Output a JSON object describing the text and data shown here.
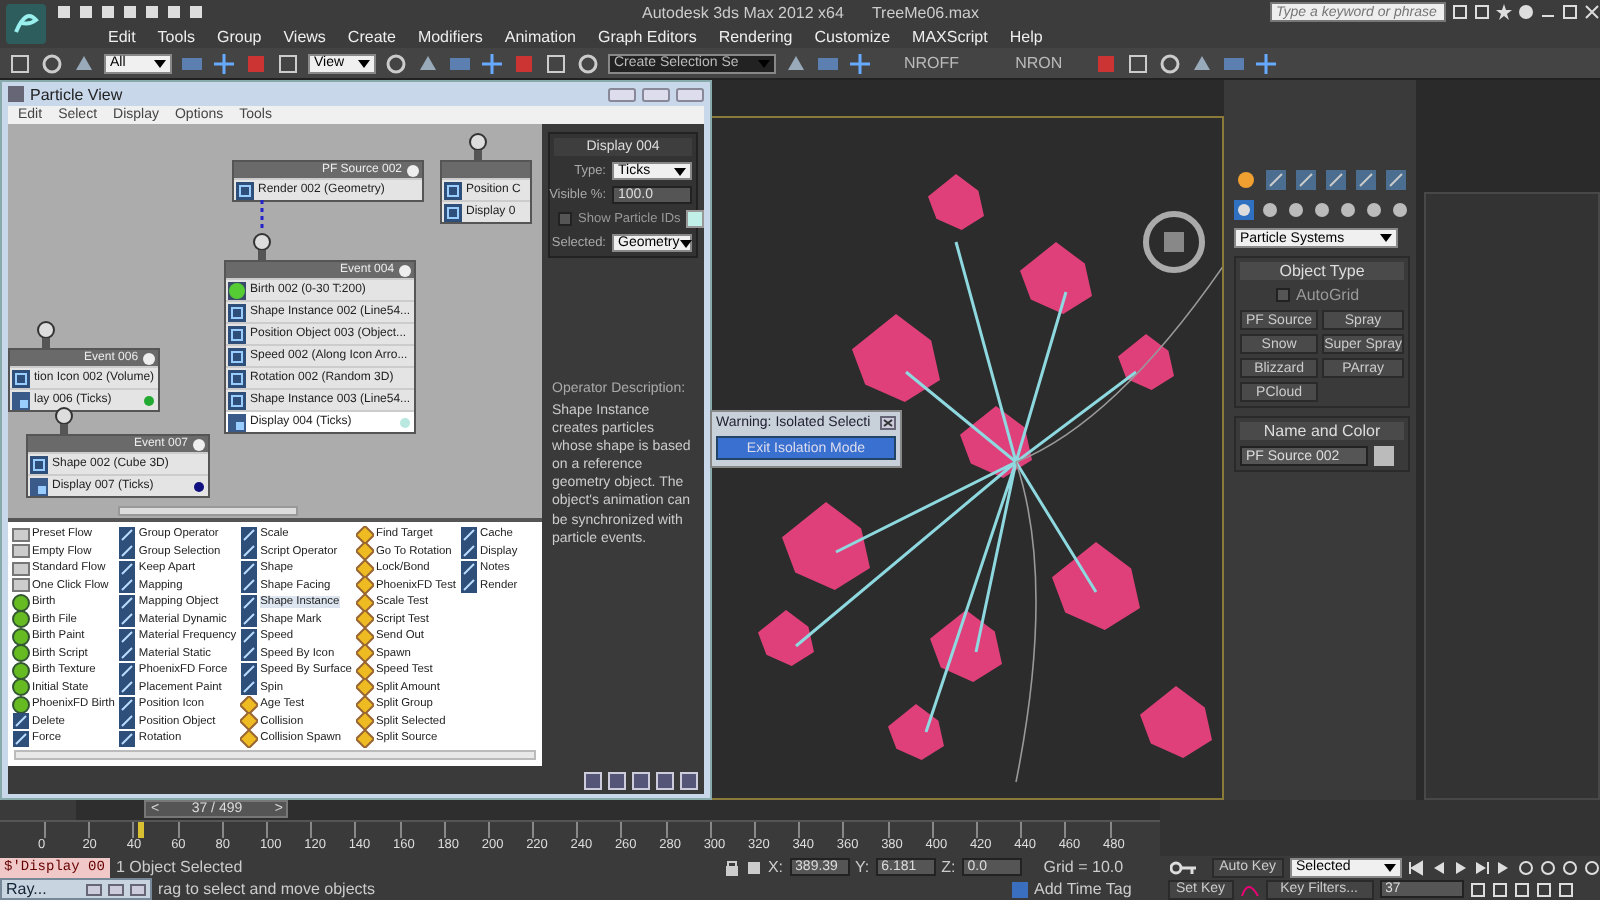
{
  "app": {
    "title": "Autodesk 3ds Max  2012 x64",
    "file": "TreeMe06.max",
    "search": {
      "placeholder": "Type a keyword or phrase"
    }
  },
  "menu": [
    "Edit",
    "Tools",
    "Group",
    "Views",
    "Create",
    "Modifiers",
    "Animation",
    "Graph Editors",
    "Rendering",
    "Customize",
    "MAXScript",
    "Help"
  ],
  "toolbar": [
    {
      "kind": "dropdown",
      "value": "All"
    },
    {
      "kind": "dropdown",
      "value": "View"
    },
    {
      "kind": "dropdown",
      "value": "Create Selection Se"
    },
    {
      "kind": "label",
      "text": "NROFF"
    },
    {
      "kind": "label",
      "text": "NRON"
    }
  ],
  "particle_view": {
    "title": "Particle View",
    "menu": [
      "Edit",
      "Select",
      "Display",
      "Options",
      "Tools"
    ],
    "nodes": [
      {
        "title": "PF Source 002",
        "kind": "source",
        "operators": [
          {
            "label": "Render 002 (Geometry)",
            "kind": "operator",
            "selected": false
          }
        ]
      },
      {
        "kind": "partial",
        "operators": [
          {
            "label": "Position C",
            "kind": "operator",
            "selected": false
          },
          {
            "label": "Display 0",
            "kind": "operator",
            "selected": false
          }
        ]
      },
      {
        "title": "Event 004",
        "kind": "event",
        "operators": [
          {
            "label": "Birth 002 (0-30 T:200)",
            "kind": "birth",
            "selected": false
          },
          {
            "label": "Shape Instance 002 (Line54...",
            "kind": "operator",
            "selected": false
          },
          {
            "label": "Position Object 003 (Object...",
            "kind": "operator",
            "selected": false
          },
          {
            "label": "Speed 002 (Along Icon Arro...",
            "kind": "operator",
            "selected": false
          },
          {
            "label": "Rotation 002 (Random 3D)",
            "kind": "operator",
            "selected": false
          },
          {
            "label": "Shape Instance 003 (Line54...",
            "kind": "operator",
            "selected": false
          },
          {
            "label": "Display 004 (Ticks)",
            "kind": "display",
            "selected": true,
            "color": "#b8e8e0"
          }
        ]
      },
      {
        "title": "Event 006",
        "kind": "event",
        "operators": [
          {
            "label": "tion Icon 002 (Volume)",
            "kind": "operator",
            "selected": false
          },
          {
            "label": "lay 006 (Ticks)",
            "kind": "display",
            "selected": false,
            "color": "#22aa33"
          }
        ]
      },
      {
        "title": "Event 007",
        "kind": "event",
        "operators": [
          {
            "label": "Shape 002 (Cube 3D)",
            "kind": "operator",
            "selected": false
          },
          {
            "label": "Display 007 (Ticks)",
            "kind": "display",
            "selected": false,
            "color": "#101080"
          }
        ]
      }
    ],
    "params": {
      "title": "Display 004",
      "type": {
        "label": "Type:",
        "value": "Ticks"
      },
      "visible": {
        "label": "Visible %:",
        "value": "100.0"
      },
      "show_ids": {
        "label": "Show Particle IDs",
        "checked": false
      },
      "selected": {
        "label": "Selected:",
        "value": "Geometry"
      }
    },
    "depot": {
      "columns": [
        [
          {
            "label": "Preset Flow",
            "kind": "flow",
            "selected": false
          },
          {
            "label": "Empty Flow",
            "kind": "flow",
            "selected": false
          },
          {
            "label": "Standard Flow",
            "kind": "flow",
            "selected": false
          },
          {
            "label": "One Click Flow",
            "kind": "flow",
            "selected": false
          },
          {
            "label": "Birth",
            "kind": "birth",
            "selected": false
          },
          {
            "label": "Birth File",
            "kind": "birth",
            "selected": false
          },
          {
            "label": "Birth Paint",
            "kind": "birth",
            "selected": false
          },
          {
            "label": "Birth Script",
            "kind": "birth",
            "selected": false
          },
          {
            "label": "Birth Texture",
            "kind": "birth",
            "selected": false
          },
          {
            "label": "Initial State",
            "kind": "birth",
            "selected": false
          },
          {
            "label": "PhoenixFD Birth",
            "kind": "birth",
            "selected": false
          },
          {
            "label": "Delete",
            "kind": "operator",
            "selected": false
          },
          {
            "label": "Force",
            "kind": "operator",
            "selected": false
          }
        ],
        [
          {
            "label": "Group Operator",
            "kind": "operator",
            "selected": false
          },
          {
            "label": "Group Selection",
            "kind": "operator",
            "selected": false
          },
          {
            "label": "Keep Apart",
            "kind": "operator",
            "selected": false
          },
          {
            "label": "Mapping",
            "kind": "operator",
            "selected": false
          },
          {
            "label": "Mapping Object",
            "kind": "operator",
            "selected": false
          },
          {
            "label": "Material Dynamic",
            "kind": "operator",
            "selected": false
          },
          {
            "label": "Material Frequency",
            "kind": "operator",
            "selected": false
          },
          {
            "label": "Material Static",
            "kind": "operator",
            "selected": false
          },
          {
            "label": "PhoenixFD Force",
            "kind": "operator",
            "selected": false
          },
          {
            "label": "Placement Paint",
            "kind": "operator",
            "selected": false
          },
          {
            "label": "Position Icon",
            "kind": "operator",
            "selected": false
          },
          {
            "label": "Position Object",
            "kind": "operator",
            "selected": false
          },
          {
            "label": "Rotation",
            "kind": "operator",
            "selected": false
          }
        ],
        [
          {
            "label": "Scale",
            "kind": "operator",
            "selected": false
          },
          {
            "label": "Script Operator",
            "kind": "operator",
            "selected": false
          },
          {
            "label": "Shape",
            "kind": "operator",
            "selected": false
          },
          {
            "label": "Shape Facing",
            "kind": "operator",
            "selected": false
          },
          {
            "label": "Shape Instance",
            "kind": "operator",
            "selected": true
          },
          {
            "label": "Shape Mark",
            "kind": "operator",
            "selected": false
          },
          {
            "label": "Speed",
            "kind": "operator",
            "selected": false
          },
          {
            "label": "Speed By Icon",
            "kind": "operator",
            "selected": false
          },
          {
            "label": "Speed By Surface",
            "kind": "operator",
            "selected": false
          },
          {
            "label": "Spin",
            "kind": "operator",
            "selected": false
          },
          {
            "label": "Age Test",
            "kind": "test",
            "selected": false
          },
          {
            "label": "Collision",
            "kind": "test",
            "selected": false
          },
          {
            "label": "Collision Spawn",
            "kind": "test",
            "selected": false
          }
        ],
        [
          {
            "label": "Find Target",
            "kind": "test",
            "selected": false
          },
          {
            "label": "Go To Rotation",
            "kind": "test",
            "selected": false
          },
          {
            "label": "Lock/Bond",
            "kind": "test",
            "selected": false
          },
          {
            "label": "PhoenixFD Test",
            "kind": "test",
            "selected": false
          },
          {
            "label": "Scale Test",
            "kind": "test",
            "selected": false
          },
          {
            "label": "Script Test",
            "kind": "test",
            "selected": false
          },
          {
            "label": "Send Out",
            "kind": "test",
            "selected": false
          },
          {
            "label": "Spawn",
            "kind": "test",
            "selected": false
          },
          {
            "label": "Speed Test",
            "kind": "test",
            "selected": false
          },
          {
            "label": "Split Amount",
            "kind": "test",
            "selected": false
          },
          {
            "label": "Split Group",
            "kind": "test",
            "selected": false
          },
          {
            "label": "Split Selected",
            "kind": "test",
            "selected": false
          },
          {
            "label": "Split Source",
            "kind": "test",
            "selected": false
          }
        ],
        [
          {
            "label": "Cache",
            "kind": "operator",
            "selected": false
          },
          {
            "label": "Display",
            "kind": "operator",
            "selected": false
          },
          {
            "label": "Notes",
            "kind": "operator",
            "selected": false
          },
          {
            "label": "Render",
            "kind": "operator",
            "selected": false
          }
        ]
      ]
    },
    "description": {
      "title": "Operator Description:",
      "text": "Shape Instance creates particles whose shape is based on a reference geometry object. The object's animation can be synchronized with particle events."
    }
  },
  "warning": {
    "title": "Warning: Isolated Selecti",
    "button": "Exit Isolation Mode"
  },
  "command_panel": {
    "category": "Particle Systems",
    "object_type": {
      "title": "Object Type",
      "autogrid": {
        "label": "AutoGrid",
        "checked": false
      },
      "buttons": [
        "PF Source",
        "Spray",
        "Snow",
        "Super Spray",
        "Blizzard",
        "PArray",
        "PCloud"
      ]
    },
    "name_color": {
      "title": "Name and Color",
      "name": "PF Source 002"
    }
  },
  "timeline": {
    "prev": "<",
    "next": ">",
    "reading": "37 / 499",
    "level": 0.074,
    "ticks": [
      "0",
      "20",
      "40",
      "60",
      "80",
      "100",
      "120",
      "140",
      "160",
      "180",
      "200",
      "220",
      "240",
      "260",
      "280",
      "300",
      "320",
      "340",
      "360",
      "380",
      "400",
      "420",
      "440",
      "460",
      "480"
    ]
  },
  "status": {
    "listener": "$'Display 00",
    "selection": "1 Object Selected",
    "prompt": "rag to select and move objects",
    "x": {
      "label": "X:",
      "value": "389.39"
    },
    "y": {
      "label": "Y:",
      "value": "6.181"
    },
    "z": {
      "label": "Z:",
      "value": "0.0"
    },
    "grid": "Grid = 10.0",
    "auto_key": "Auto Key",
    "key_mode": "Selected",
    "set_key": "Set Key",
    "key_filters": "Key Filters...",
    "frame": "37",
    "time_tag": "Add Time Tag",
    "minimized": "Ray..."
  }
}
